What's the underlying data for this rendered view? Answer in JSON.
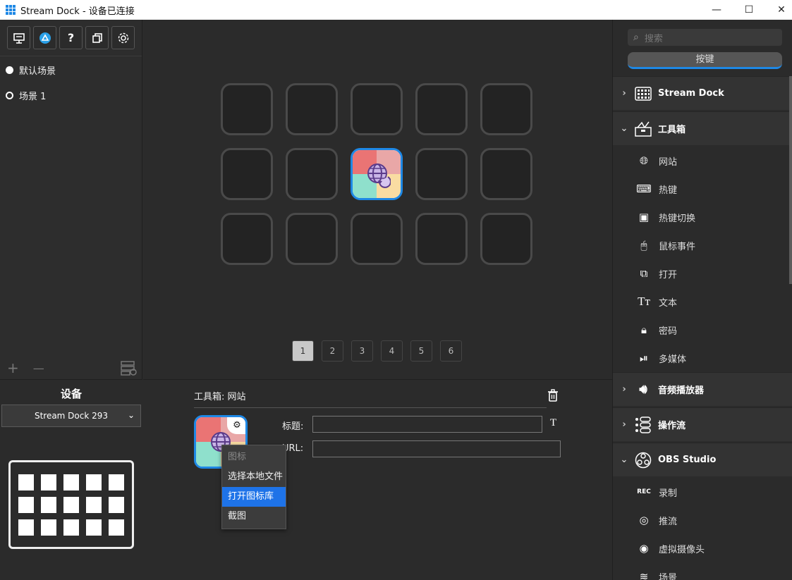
{
  "window": {
    "title": "Stream Dock - 设备已连接",
    "minimize": "—",
    "maximize": "☐",
    "close": "✕"
  },
  "left": {
    "toolbar": [
      {
        "name": "presentation-icon",
        "glyph": "凚"
      },
      {
        "name": "store-icon",
        "glyph": "◉"
      },
      {
        "name": "help-icon",
        "glyph": "?"
      },
      {
        "name": "copy-icon",
        "glyph": "⧉"
      },
      {
        "name": "settings-icon",
        "glyph": "⚙"
      }
    ],
    "scenes": [
      "默认场景",
      "场景 1"
    ],
    "add": "+",
    "remove": "—",
    "device_title": "设备",
    "device_select": "Stream Dock 293"
  },
  "pages": [
    "1",
    "2",
    "3",
    "4",
    "5",
    "6"
  ],
  "props": {
    "header": "工具箱: 网站",
    "title_label": "标题:",
    "url_label": "URL:",
    "title_value": "",
    "url_value": "",
    "text_style": "T"
  },
  "context_menu": {
    "header": "图标",
    "items": [
      "选择本地文件",
      "打开图标库",
      "截图"
    ]
  },
  "right": {
    "search_placeholder": "搜索",
    "tab": "按键",
    "categories": [
      {
        "label": "Stream Dock",
        "chev": "›"
      },
      {
        "label": "工具箱",
        "chev": "⌄"
      },
      {
        "label": "音频播放器",
        "chev": "›"
      },
      {
        "label": "操作流",
        "chev": "›"
      },
      {
        "label": "OBS Studio",
        "chev": "⌄"
      }
    ],
    "toolbox_items": [
      "网站",
      "热键",
      "热键切换",
      "鼠标事件",
      "打开",
      "文本",
      "密码",
      "多媒体"
    ],
    "obs_items": [
      "录制",
      "推流",
      "虚拟摄像头",
      "场景"
    ]
  },
  "colors": {
    "accent": "#1e88e5",
    "bg": "#2b2b2b"
  }
}
